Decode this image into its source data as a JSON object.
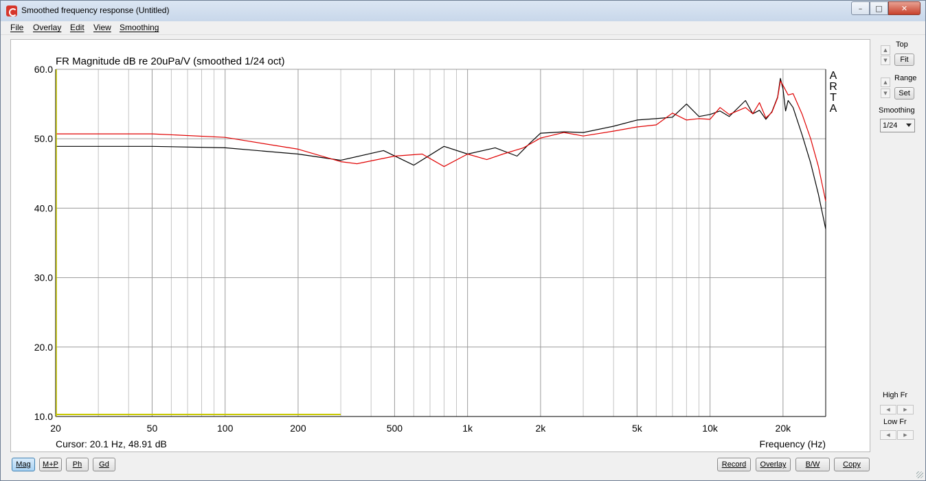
{
  "window": {
    "title": "Smoothed frequency response (Untitled)",
    "minimize_label": "–",
    "maximize_label": "□",
    "close_label": "✕"
  },
  "menu": [
    "File",
    "Overlay",
    "Edit",
    "View",
    "Smoothing"
  ],
  "chart_data": {
    "type": "line",
    "title": "FR Magnitude dB re 20uPa/V (smoothed 1/24 oct)",
    "watermark": [
      "A",
      "R",
      "T",
      "A"
    ],
    "xlabel": "Frequency (Hz)",
    "x_scale": "log",
    "xlim": [
      20,
      30000
    ],
    "ylim": [
      10,
      60
    ],
    "x_ticks": [
      20,
      50,
      100,
      200,
      500,
      1000,
      2000,
      5000,
      10000,
      20000
    ],
    "x_tick_labels": [
      "20",
      "50",
      "100",
      "200",
      "500",
      "1k",
      "2k",
      "5k",
      "10k",
      "20k"
    ],
    "y_ticks": [
      10,
      20,
      30,
      40,
      50,
      60
    ],
    "y_tick_labels": [
      "10.0",
      "20.0",
      "30.0",
      "40.0",
      "50.0",
      "60.0"
    ],
    "grid": true,
    "cursor_text": "Cursor: 20.1 Hz, 48.91 dB",
    "series": [
      {
        "color": "#000000",
        "x": [
          20,
          50,
          100,
          200,
          300,
          450,
          600,
          800,
          1000,
          1300,
          1600,
          1800,
          2000,
          2500,
          3000,
          4000,
          5000,
          6000,
          7000,
          8000,
          9000,
          10000,
          11000,
          12000,
          14000,
          15000,
          16000,
          17000,
          18000,
          19000,
          19500,
          20000,
          20500,
          21000,
          22000,
          24000,
          26000,
          28000,
          30000
        ],
        "y": [
          48.9,
          48.9,
          48.7,
          47.8,
          46.9,
          48.3,
          46.2,
          48.9,
          47.8,
          48.7,
          47.5,
          49.3,
          50.8,
          51.0,
          50.9,
          51.8,
          52.7,
          52.9,
          53.1,
          55.0,
          53.2,
          53.5,
          54.0,
          53.2,
          55.5,
          53.6,
          54.1,
          52.8,
          53.9,
          56.0,
          58.7,
          57.2,
          54.0,
          55.5,
          54.5,
          50.5,
          46.5,
          42.0,
          37.0
        ]
      },
      {
        "color": "#e00000",
        "x": [
          20,
          50,
          100,
          200,
          300,
          350,
          500,
          650,
          800,
          1000,
          1200,
          1400,
          1700,
          2000,
          2500,
          3000,
          4000,
          5000,
          6000,
          7000,
          8000,
          9000,
          10000,
          11000,
          12000,
          14000,
          15000,
          16000,
          17000,
          18000,
          19000,
          19500,
          20000,
          21000,
          22000,
          24000,
          26000,
          28000,
          30000
        ],
        "y": [
          50.7,
          50.7,
          50.2,
          48.5,
          46.7,
          46.4,
          47.5,
          47.8,
          46.0,
          47.8,
          47.0,
          47.8,
          48.7,
          50.1,
          50.9,
          50.4,
          51.1,
          51.7,
          52.0,
          53.7,
          52.7,
          52.9,
          52.8,
          54.5,
          53.5,
          54.5,
          53.6,
          55.2,
          53.0,
          53.8,
          55.9,
          58.3,
          57.7,
          56.3,
          56.5,
          53.5,
          50.0,
          46.0,
          41.0
        ]
      },
      {
        "color": "#c8c800",
        "x": [
          20,
          300
        ],
        "y": [
          10.3,
          10.3
        ]
      }
    ]
  },
  "side_panel": {
    "top_label": "Top",
    "fit_label": "Fit",
    "range_label": "Range",
    "set_label": "Set",
    "smoothing_label": "Smoothing",
    "smoothing_value": "1/24",
    "high_fr_label": "High Fr",
    "low_fr_label": "Low Fr"
  },
  "bottom_tabs": [
    "Mag",
    "M+P",
    "Ph",
    "Gd"
  ],
  "bottom_actions": [
    "Record",
    "Overlay",
    "B/W",
    "Copy"
  ]
}
